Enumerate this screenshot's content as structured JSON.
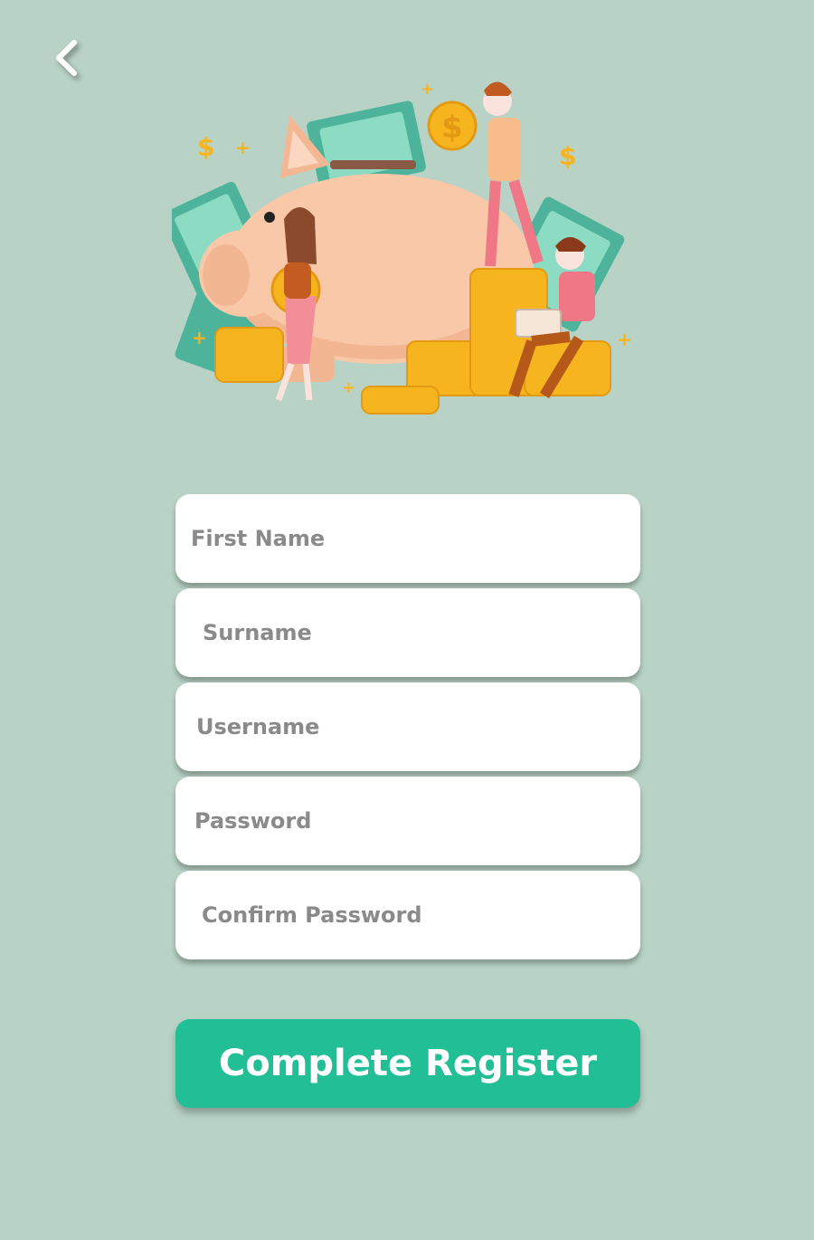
{
  "header": {
    "back_icon": "chevron-left-icon"
  },
  "hero": {
    "illustration": "piggy-bank-savings-illustration"
  },
  "form": {
    "fields": [
      {
        "placeholder": "First Name",
        "value": ""
      },
      {
        "placeholder": "Surname",
        "value": ""
      },
      {
        "placeholder": "Username",
        "value": ""
      },
      {
        "placeholder": "Password",
        "value": ""
      },
      {
        "placeholder": "Confirm Password",
        "value": ""
      }
    ],
    "submit_label": "Complete Register"
  },
  "colors": {
    "background": "#b8d3c6",
    "button": "#22be95",
    "field": "#ffffff",
    "placeholder": "#8a8a8a"
  }
}
